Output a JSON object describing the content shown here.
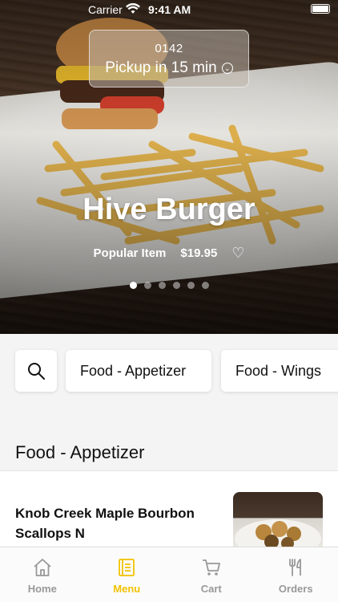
{
  "status": {
    "carrier": "Carrier",
    "time": "9:41 AM"
  },
  "pickup": {
    "code": "0142",
    "label": "Pickup in 15 min"
  },
  "hero": {
    "title": "Hive Burger",
    "tag": "Popular Item",
    "price": "$19.95",
    "slide_count": 6,
    "active_slide": 1
  },
  "categories": [
    "Food - Appetizer",
    "Food - Wings"
  ],
  "section": {
    "title": "Food - Appetizer"
  },
  "items": [
    {
      "name": "Knob Creek Maple Bourbon Scallops N"
    }
  ],
  "tabs": [
    {
      "label": "Home",
      "icon": "home-icon"
    },
    {
      "label": "Menu",
      "icon": "menu-book-icon"
    },
    {
      "label": "Cart",
      "icon": "cart-icon"
    },
    {
      "label": "Orders",
      "icon": "fork-knife-icon"
    }
  ],
  "colors": {
    "accent": "#f2c200"
  }
}
